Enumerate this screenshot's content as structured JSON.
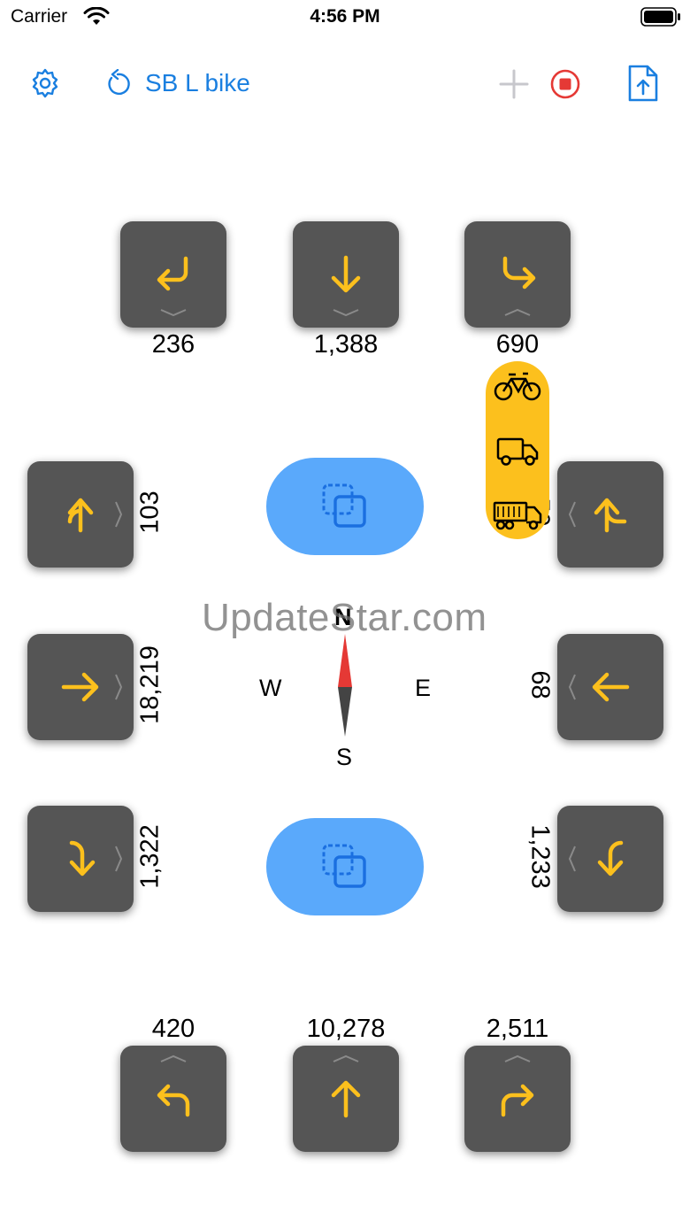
{
  "status_bar": {
    "carrier": "Carrier",
    "time": "4:56 PM"
  },
  "toolbar": {
    "session_label": "SB L bike"
  },
  "counts": {
    "north_left": "236",
    "north_thru": "1,388",
    "north_right": "690",
    "west_top": "103",
    "west_mid": "18,219",
    "west_bot": "1,322",
    "east_top": "59",
    "east_mid": "68",
    "east_bot": "1,233",
    "south_left": "420",
    "south_thru": "10,278",
    "south_right": "2,511"
  },
  "compass": {
    "n": "N",
    "s": "S",
    "e": "E",
    "w": "W"
  },
  "watermark": "UpdateStar.com",
  "colors": {
    "accent": "#1a7fe0",
    "arrow": "#fcc01d",
    "tile": "#555555",
    "pill": "#5aa9fb",
    "record": "#e53935"
  },
  "vehicle_modes": [
    "bicycle-icon",
    "truck-icon",
    "semi-truck-icon"
  ]
}
